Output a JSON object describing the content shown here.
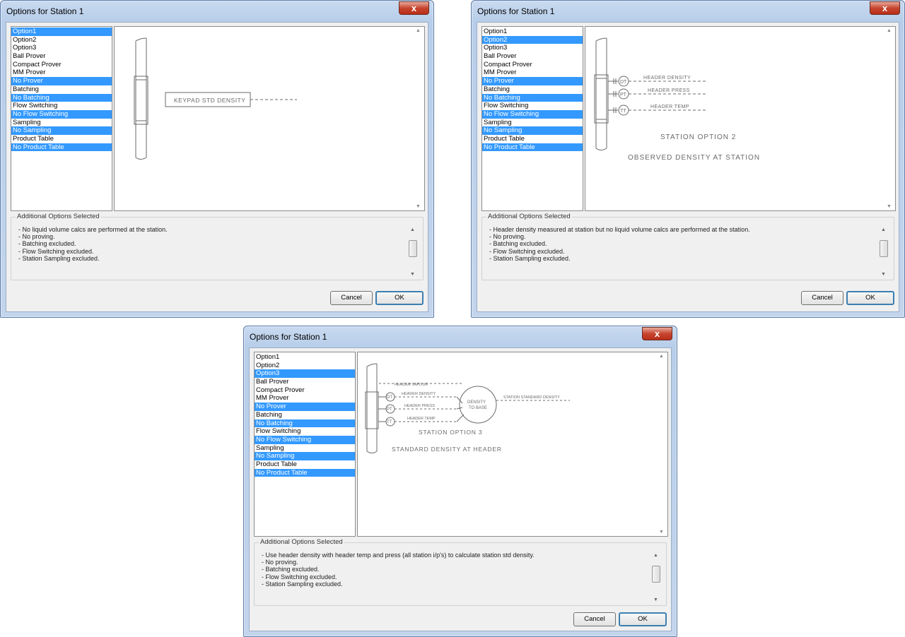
{
  "list_items": [
    "Option1",
    "Option2",
    "Option3",
    "Ball Prover",
    "Compact Prover",
    "MM Prover",
    "No Prover",
    "Batching",
    "No Batching",
    "Flow Switching",
    "No Flow Switching",
    "Sampling",
    "No Sampling",
    "Product Table",
    "No Product Table"
  ],
  "group_label": "Additional Options Selected",
  "cancel_label": "Cancel",
  "ok_label": "OK",
  "close_glyph": "x",
  "colors": {
    "selection": "#3399ff",
    "title_bar": "#c3d5ec",
    "close": "#c7452f"
  },
  "dialogs": [
    {
      "title": "Options for Station 1",
      "selected": [
        0,
        6,
        8,
        10,
        12,
        14
      ],
      "diagram": {
        "keypad_label": "KEYPAD STD DENSITY"
      },
      "notes": [
        "- No liquid volume calcs are performed at the station.",
        "- No proving.",
        "- Batching excluded.",
        "- Flow Switching excluded.",
        "- Station Sampling excluded."
      ]
    },
    {
      "title": "Options for Station 1",
      "selected": [
        1,
        6,
        8,
        10,
        12,
        14
      ],
      "diagram": {
        "instruments": [
          "DT",
          "PT",
          "TT"
        ],
        "signals": [
          "HEADER DENSITY",
          "HEADER PRESS",
          "HEADER TEMP"
        ],
        "caption1": "STATION OPTION 2",
        "caption2": "OBSERVED DENSITY AT STATION"
      },
      "notes": [
        "- Header density measured at station but no liquid volume calcs are performed at the station.",
        "- No proving.",
        "- Batching excluded.",
        "- Flow Switching excluded.",
        "- Station Sampling excluded."
      ]
    },
    {
      "title": "Options for Station 1",
      "selected": [
        2,
        6,
        8,
        10,
        12,
        14
      ],
      "diagram": {
        "vapour_label": "HEADER VAPOUR",
        "instruments": [
          "DT",
          "PT",
          "TT"
        ],
        "signals": [
          "HEADER DENSITY",
          "HEADER PRESS",
          "HEADER TEMP"
        ],
        "calc_line1": "DENSITY",
        "calc_line2": "TO BASE",
        "output_label": "STATION STANDARD DENSITY",
        "caption1": "STATION OPTION 3",
        "caption2": "STANDARD DENSITY AT HEADER"
      },
      "notes": [
        "- Use header density with header temp and press (all station i/p's) to calculate station std density.",
        "- No proving.",
        "- Batching excluded.",
        "- Flow Switching excluded.",
        "- Station Sampling excluded."
      ]
    }
  ]
}
